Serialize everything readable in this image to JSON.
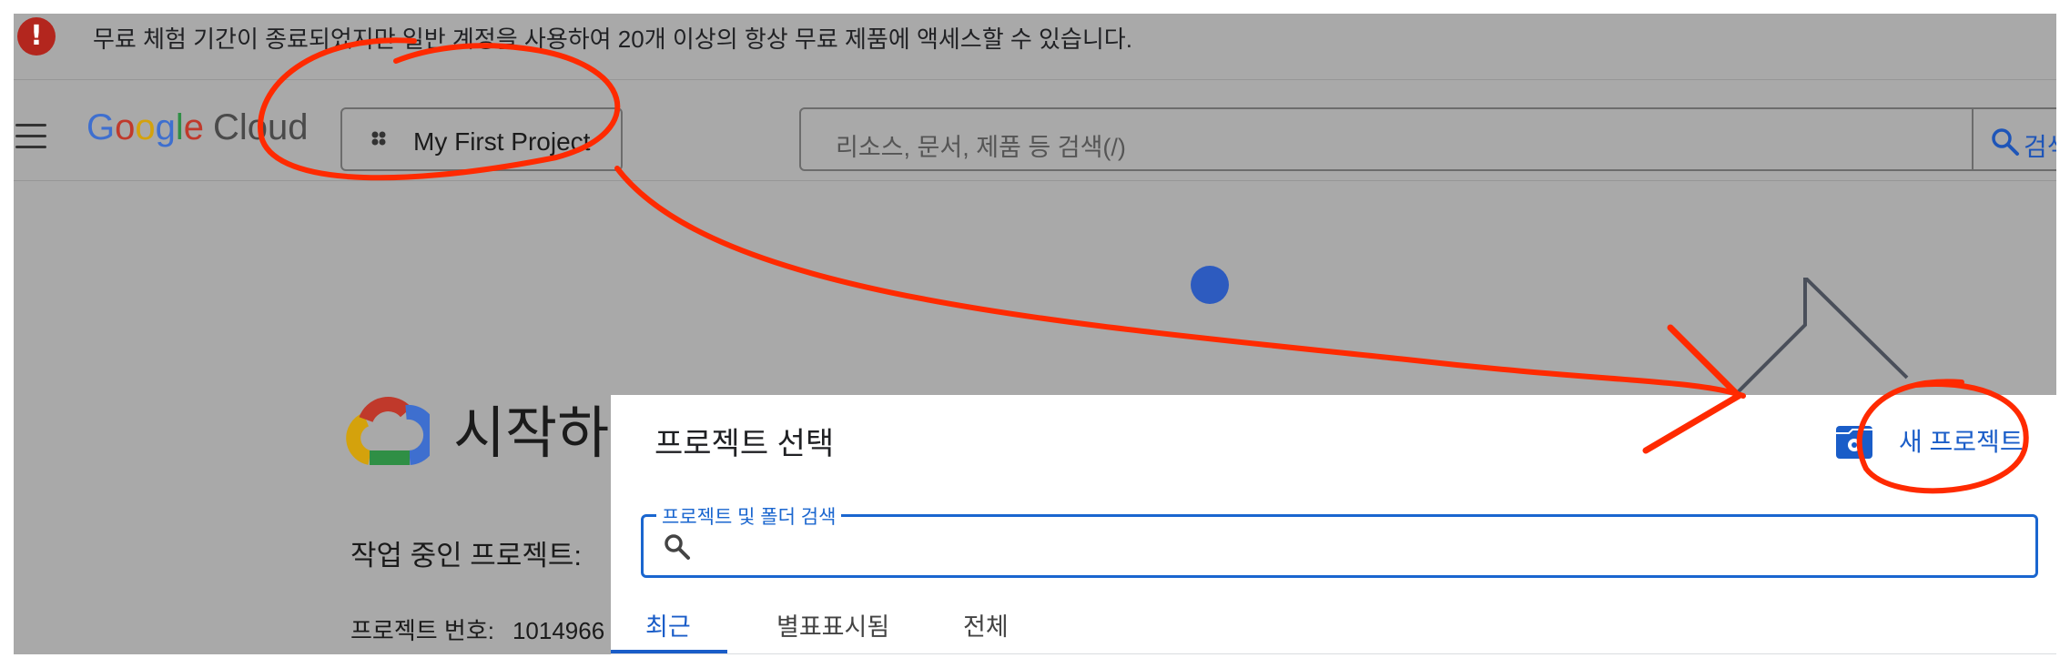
{
  "notice": {
    "icon": "error-icon",
    "text": "무료 체험 기간이 종료되었지만 일반 계정을 사용하여 20개 이상의 항상 무료 제품에 액세스할 수 있습니다."
  },
  "header": {
    "menu_icon": "hamburger-menu-icon",
    "logo": {
      "google_letters": [
        "G",
        "o",
        "o",
        "g",
        "l",
        "e"
      ],
      "cloud": "Cloud"
    },
    "project_picker": {
      "label": "My First Project",
      "icon": "project-dots-icon"
    },
    "search": {
      "placeholder": "리소스, 문서, 제품 등 검색(/)",
      "button_label": "검색",
      "icon": "search-icon"
    }
  },
  "main": {
    "title": "시작하",
    "working_project_label": "작업 중인 프로젝트:",
    "project_number_label": "프로젝트 번호:",
    "project_number_value": "1014966"
  },
  "dialog": {
    "title": "프로젝트 선택",
    "new_project_label": "새 프로젝트",
    "manage_icon": "manage-resources-icon",
    "search_legend": "프로젝트 및 폴더 검색",
    "search_value": "",
    "tabs": [
      {
        "label": "최근",
        "active": true
      },
      {
        "label": "별표표시됨",
        "active": false
      },
      {
        "label": "전체",
        "active": false
      }
    ]
  },
  "colors": {
    "overlay_gray": "#a9a9a9",
    "accent_blue": "#1a5dc8",
    "annotation_red": "#ff2a00",
    "error_red": "#b3261e"
  }
}
